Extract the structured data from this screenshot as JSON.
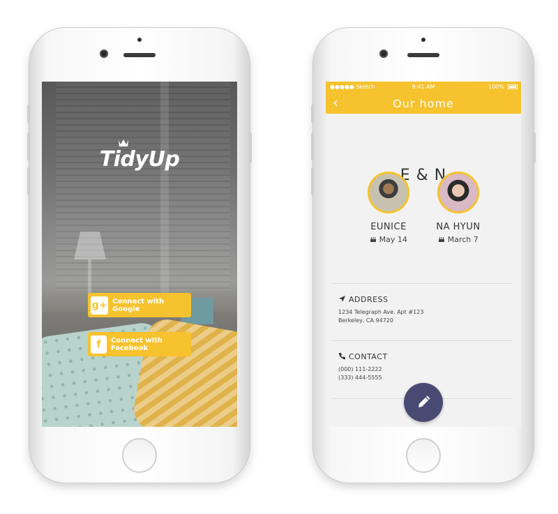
{
  "left_phone": {
    "app_logo": "TidyUp",
    "google_button_label": "Connect with Google",
    "google_icon_glyph": "g+",
    "facebook_button_label": "Connect with Facebook",
    "facebook_icon_glyph": "f"
  },
  "right_phone": {
    "status": {
      "carrier": "●●●●● Sketch",
      "time": "9:41 AM",
      "battery": "100%"
    },
    "nav": {
      "back_glyph": "‹",
      "title": "Our home"
    },
    "household_name": "E & N",
    "members": [
      {
        "name": "EUNICE",
        "birthday": "May 14"
      },
      {
        "name": "NA HYUN",
        "birthday": "March 7"
      }
    ],
    "address": {
      "title": "ADDRESS",
      "line1": "1234 Telegraph Ave. Apt #123",
      "line2": "Berkeley, CA 94720"
    },
    "contact": {
      "title": "CONTACT",
      "phone1": "(000) 111-2222",
      "phone2": "(333) 444-5555"
    }
  },
  "colors": {
    "accent": "#f6c22d",
    "fab": "#494a73"
  }
}
